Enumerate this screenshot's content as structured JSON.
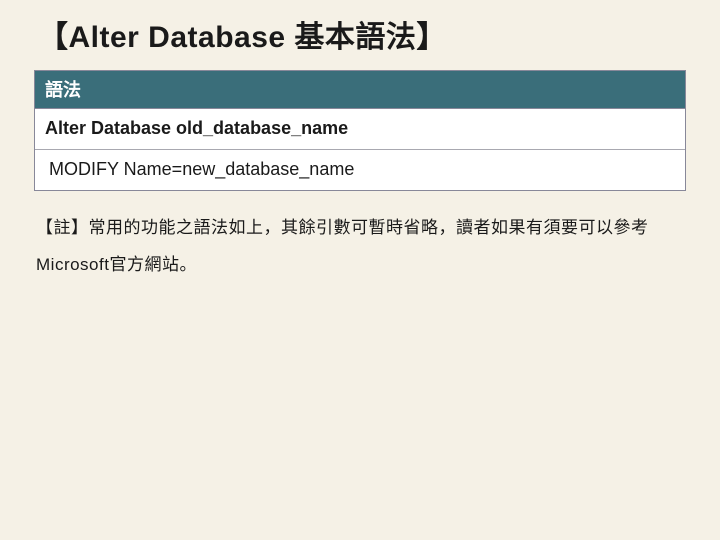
{
  "title": "【Alter Database 基本語法】",
  "syntax": {
    "header": "語法",
    "line1": "Alter Database old_database_name",
    "line2": "MODIFY Name=new_database_name"
  },
  "note": "【註】常用的功能之語法如上，其餘引數可暫時省略，讀者如果有須要可以參考Microsoft官方網站。"
}
